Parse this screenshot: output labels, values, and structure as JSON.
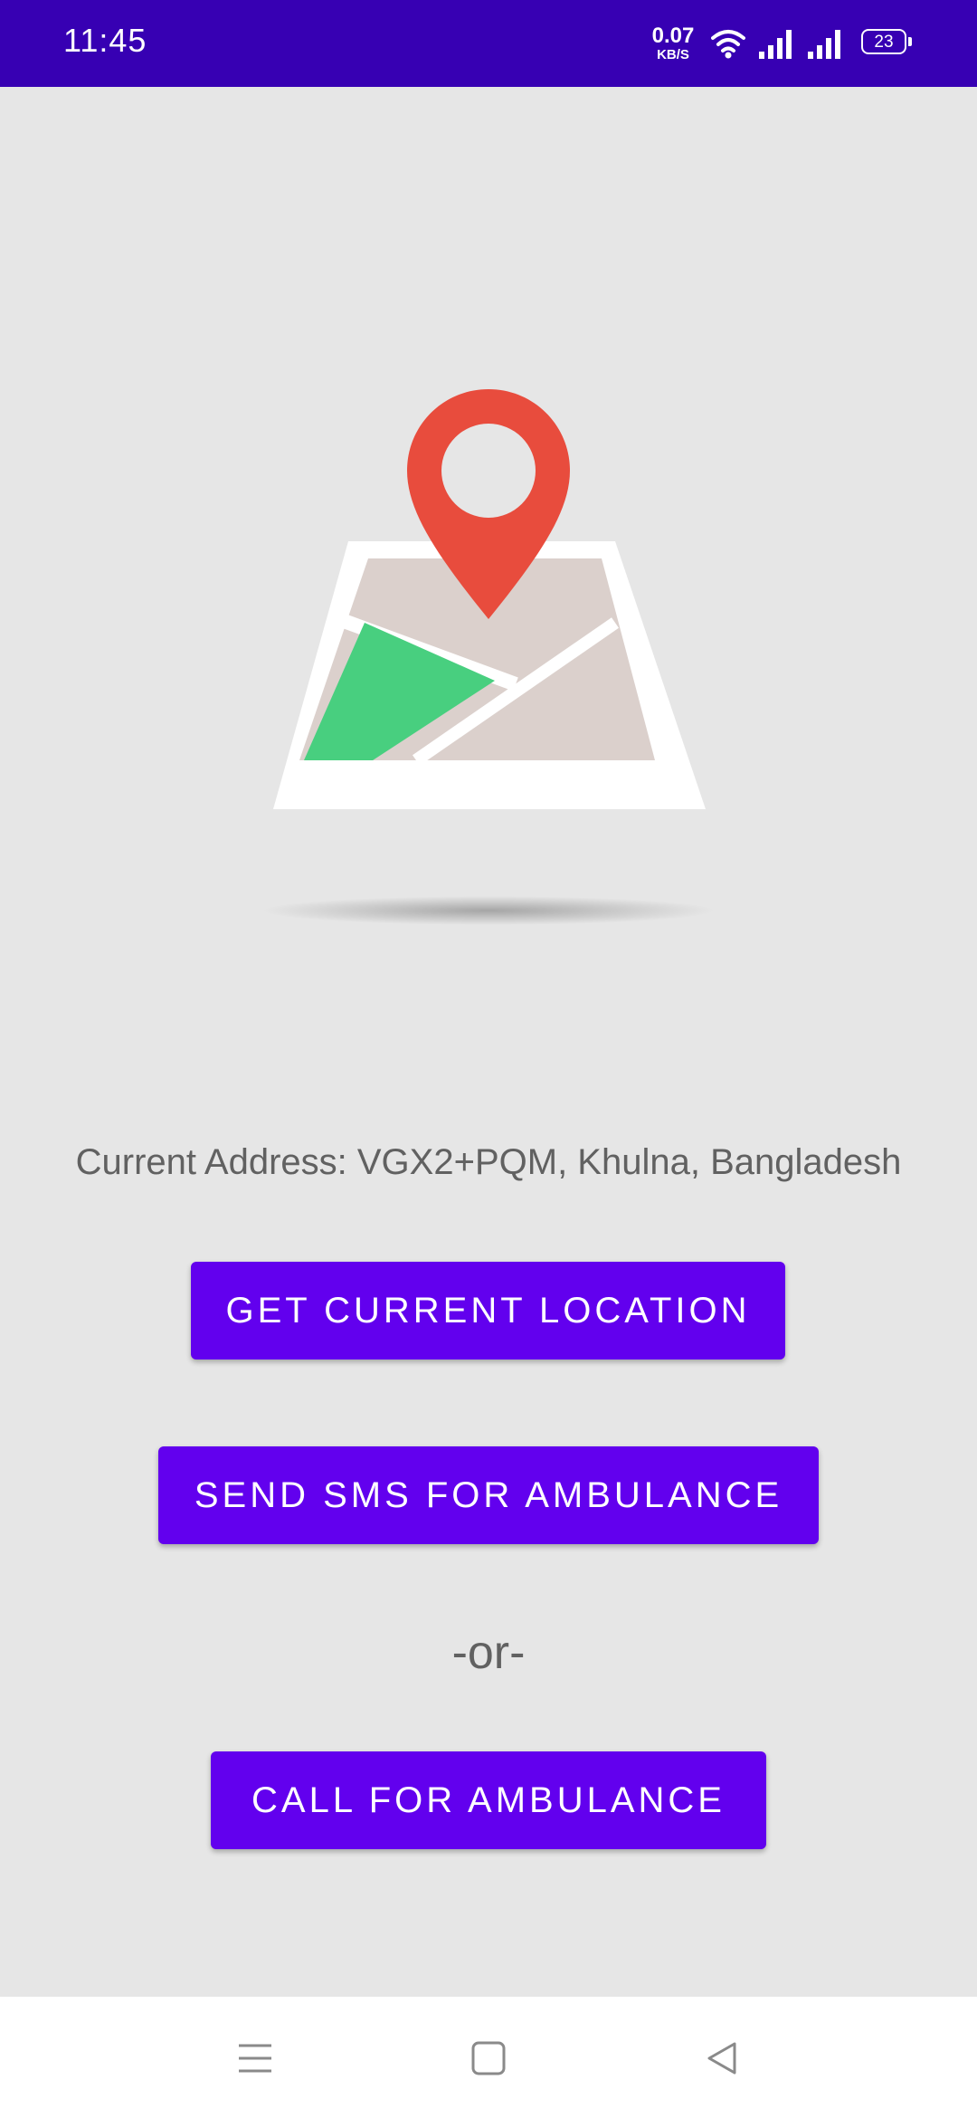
{
  "status_bar": {
    "time": "11:45",
    "net_speed_value": "0.07",
    "net_speed_unit": "KB/S",
    "battery_level": "23",
    "icons": [
      "wifi-icon",
      "signal-1-icon",
      "signal-2-icon",
      "battery-icon"
    ]
  },
  "main": {
    "address_text": "Current Address: VGX2+PQM, Khulna, Bangladesh",
    "get_location_label": "GET CURRENT LOCATION",
    "send_sms_label": "SEND SMS FOR AMBULANCE",
    "or_label": "-or-",
    "call_label": "CALL FOR AMBULANCE",
    "illustration": "map-pin-illustration"
  },
  "nav_bar": {
    "icons": [
      "menu-icon",
      "home-icon",
      "back-icon"
    ]
  },
  "colors": {
    "status_bar": "#3700b3",
    "button": "#6200ee",
    "background": "#e6e6e6",
    "pin": "#e84c3d",
    "map_green": "#48cf7f",
    "map_beige": "#dbd0cc"
  }
}
